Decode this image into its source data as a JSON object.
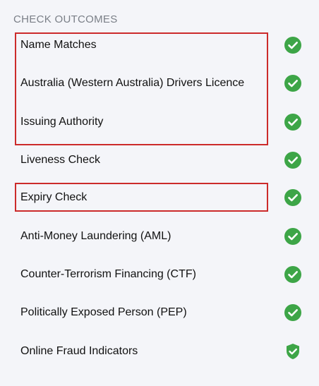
{
  "section": {
    "title": "CHECK OUTCOMES"
  },
  "colors": {
    "success_green": "#3da547",
    "highlight_red": "#cc2b2b",
    "title_gray": "#7a7f87"
  },
  "checks": [
    {
      "label": "Name Matches",
      "status": "passed",
      "icon": "check-circle-icon",
      "highlighted": true
    },
    {
      "label": "Australia (Western Australia) Drivers Licence",
      "status": "passed",
      "icon": "check-circle-icon",
      "highlighted": true
    },
    {
      "label": "Issuing Authority",
      "status": "passed",
      "icon": "check-circle-icon",
      "highlighted": true
    },
    {
      "label": "Liveness Check",
      "status": "passed",
      "icon": "check-circle-icon",
      "highlighted": false
    },
    {
      "label": "Expiry Check",
      "status": "passed",
      "icon": "check-circle-icon",
      "highlighted": true
    },
    {
      "label": "Anti-Money Laundering (AML)",
      "status": "passed",
      "icon": "check-circle-icon",
      "highlighted": false
    },
    {
      "label": "Counter-Terrorism Financing (CTF)",
      "status": "passed",
      "icon": "check-circle-icon",
      "highlighted": false
    },
    {
      "label": "Politically Exposed Person (PEP)",
      "status": "passed",
      "icon": "check-circle-icon",
      "highlighted": false
    },
    {
      "label": "Online Fraud Indicators",
      "status": "passed",
      "icon": "shield-check-icon",
      "highlighted": false
    }
  ]
}
